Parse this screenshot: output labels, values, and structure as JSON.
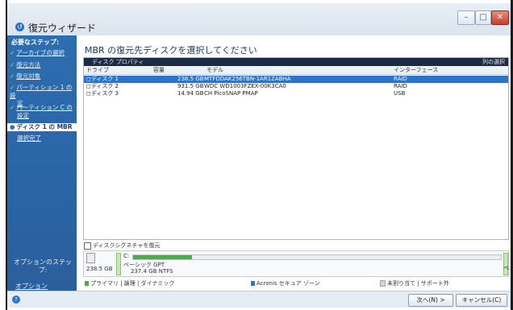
{
  "window": {
    "title": "復元ウィザード",
    "controls": {
      "minimize": "–",
      "maximize": "□",
      "close": "✕"
    }
  },
  "sidebar": {
    "heading": "必要なステップ:",
    "steps": [
      {
        "label": "アーカイブの選択",
        "done": true
      },
      {
        "label": "復元方法",
        "done": true
      },
      {
        "label": "復元対象",
        "done": true
      },
      {
        "label": "パーティション 1 の設",
        "label2": "定",
        "done": true
      },
      {
        "label": "パーティション C の",
        "label2": "設定",
        "done": true
      },
      {
        "label": "ディスク 1 の MBR",
        "current": true
      },
      {
        "label": "選択完了"
      }
    ],
    "optional_heading": "オプションのステップ:",
    "options_link": "オプション"
  },
  "main": {
    "heading": "MBR の復元先ディスクを選択してください",
    "panel_title": "ディスク プロパティ",
    "panel_action": "列の選択",
    "columns": [
      "ドライブ",
      "容量",
      "モデル",
      "インターフェース"
    ],
    "rows": [
      {
        "drive": "ディスク 1",
        "capacity": "238.5 GB",
        "model": "MTFDDAK256TBN-1AR1ZABHA",
        "interface": "RAID",
        "selected": true
      },
      {
        "drive": "ディスク 2",
        "capacity": "931.5 GB",
        "model": "WDC WD1003FZEX-00K3CA0",
        "interface": "RAID",
        "selected": false
      },
      {
        "drive": "ディスク 3",
        "capacity": "14.94 GB",
        "model": "CH PicoSNAP PMAP",
        "interface": "USB",
        "selected": false
      }
    ],
    "disk_signature_checkbox": "ディスクシグネチャを復元",
    "disk_signature_checked": false
  },
  "disk_map": {
    "disk_size": "238.5 GB",
    "disk_type": "ベーシック GPT",
    "partition_letter": "C:",
    "partition_size": "237.4 GB NTFS",
    "used_fraction": 0.16,
    "end_label": "ベ..."
  },
  "legend": {
    "primary": "プライマリ | 論理 | ダイナミック",
    "acronis": "Acronis セキュア ゾーン",
    "unallocated": "未割り当て | サポート外"
  },
  "footer": {
    "next": "次へ(N) >",
    "cancel": "キャンセル(C)"
  },
  "colors": {
    "sidebar": "#2b66a8",
    "selection": "#2f73c9",
    "primary_swatch": "#45b33c",
    "acronis_swatch": "#2f73c9",
    "unallocated_swatch": "#cfd5dc"
  }
}
